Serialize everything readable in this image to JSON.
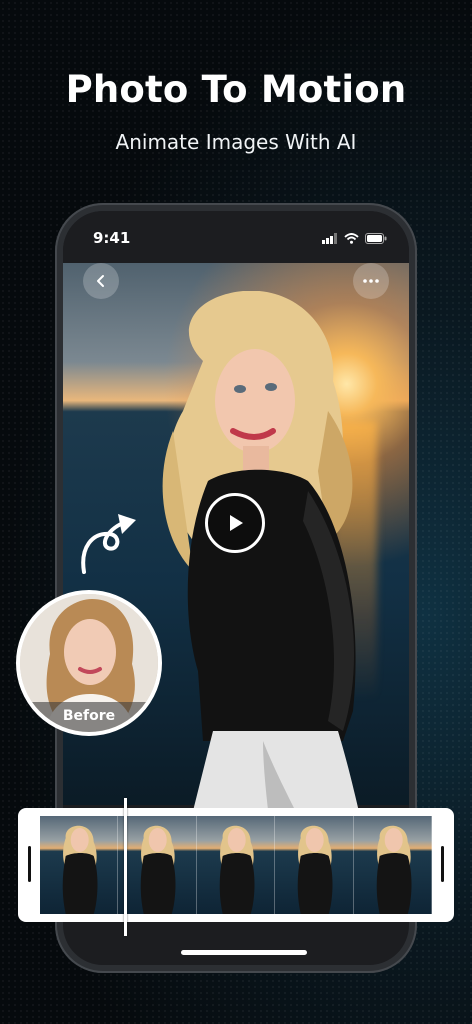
{
  "hero": {
    "title": "Photo To Motion",
    "subtitle": "Animate Images With AI"
  },
  "phone": {
    "status_time": "9:41",
    "icons": [
      "back-icon",
      "more-icon",
      "play-icon",
      "signal-icon",
      "wifi-icon",
      "battery-icon"
    ]
  },
  "before_card": {
    "label": "Before"
  },
  "timeline": {
    "frame_count": 5
  },
  "colors": {
    "accent": "#ffffff",
    "background": "#0a1820",
    "phone_frame": "#2c2f33"
  }
}
